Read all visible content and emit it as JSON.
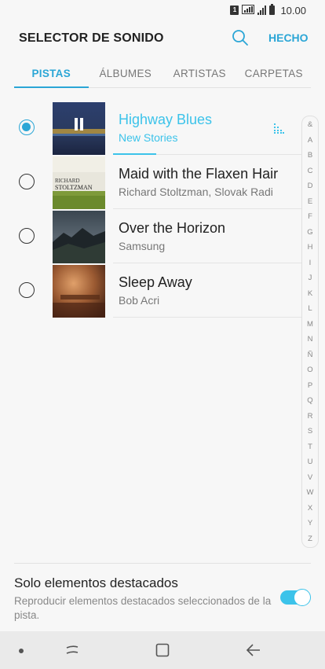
{
  "status_bar": {
    "sim": "1",
    "time": "10.00"
  },
  "app_bar": {
    "title": "SELECTOR DE SONIDO",
    "done_label": "HECHO"
  },
  "tabs": [
    {
      "label": "PISTAS",
      "active": true
    },
    {
      "label": "ÁLBUMES",
      "active": false
    },
    {
      "label": "ARTISTAS",
      "active": false
    },
    {
      "label": "CARPETAS",
      "active": false
    }
  ],
  "tracks": [
    {
      "title": "Highway Blues",
      "artist": "New Stories",
      "selected": true,
      "playing": true,
      "progress": 0.23
    },
    {
      "title": "Maid with the Flaxen Hair",
      "artist": "Richard Stoltzman, Slovak Radi",
      "selected": false,
      "playing": false,
      "art_text": [
        "RICHARD",
        "STOLTZMAN"
      ]
    },
    {
      "title": "Over the Horizon",
      "artist": "Samsung",
      "selected": false,
      "playing": false
    },
    {
      "title": "Sleep Away",
      "artist": "Bob Acri",
      "selected": false,
      "playing": false
    }
  ],
  "index_letters": [
    "&",
    "A",
    "B",
    "C",
    "D",
    "E",
    "F",
    "G",
    "H",
    "I",
    "J",
    "K",
    "L",
    "M",
    "N",
    "Ñ",
    "O",
    "P",
    "Q",
    "R",
    "S",
    "T",
    "U",
    "V",
    "W",
    "X",
    "Y",
    "Z"
  ],
  "highlights_setting": {
    "title": "Solo elementos destacados",
    "description": "Reproducir elementos destacados seleccionados de la pista.",
    "enabled": true
  },
  "colors": {
    "accent": "#2ba6d6",
    "playing": "#3cc3ea"
  }
}
